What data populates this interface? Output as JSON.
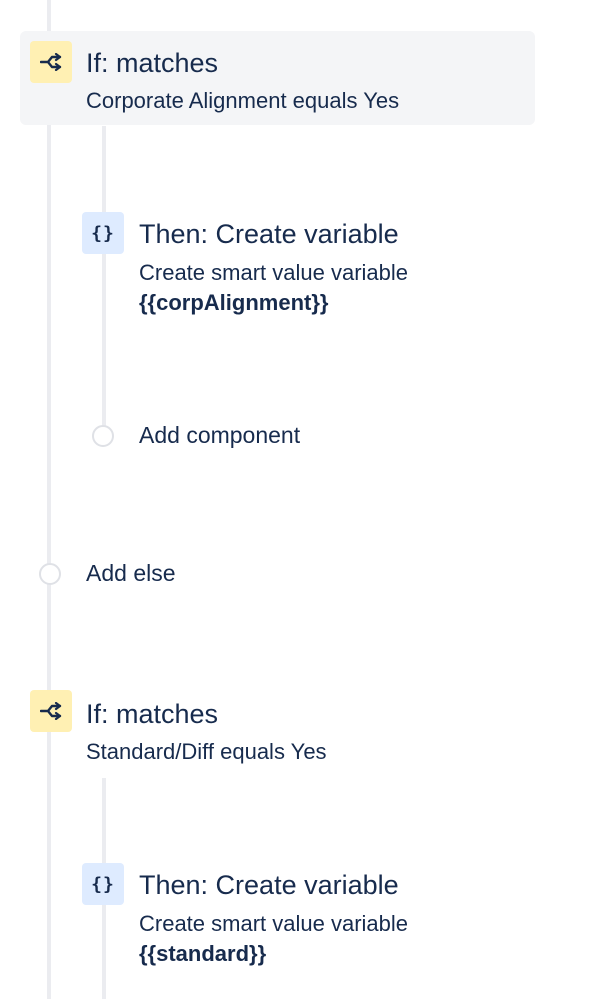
{
  "blocks": [
    {
      "icon": "branch-icon",
      "title": "If: matches",
      "description": "Corporate Alignment equals Yes"
    },
    {
      "icon": "braces-icon",
      "icon_text": "{}",
      "title": "Then: Create variable",
      "description": "Create smart value variable",
      "variable": "{{corpAlignment}}"
    },
    {
      "add_label": "Add component"
    },
    {
      "add_label": "Add else"
    },
    {
      "icon": "branch-icon",
      "title": "If: matches",
      "description": "Standard/Diff equals Yes"
    },
    {
      "icon": "braces-icon",
      "icon_text": "{}",
      "title": "Then: Create variable",
      "description": "Create smart value variable",
      "variable": "{{standard}}"
    }
  ],
  "colors": {
    "text": "#172b4d",
    "rail": "#ebecf0",
    "selected_bg": "#f4f5f7",
    "condition_icon_bg": "#fff0b3",
    "action_icon_bg": "#deebff"
  }
}
